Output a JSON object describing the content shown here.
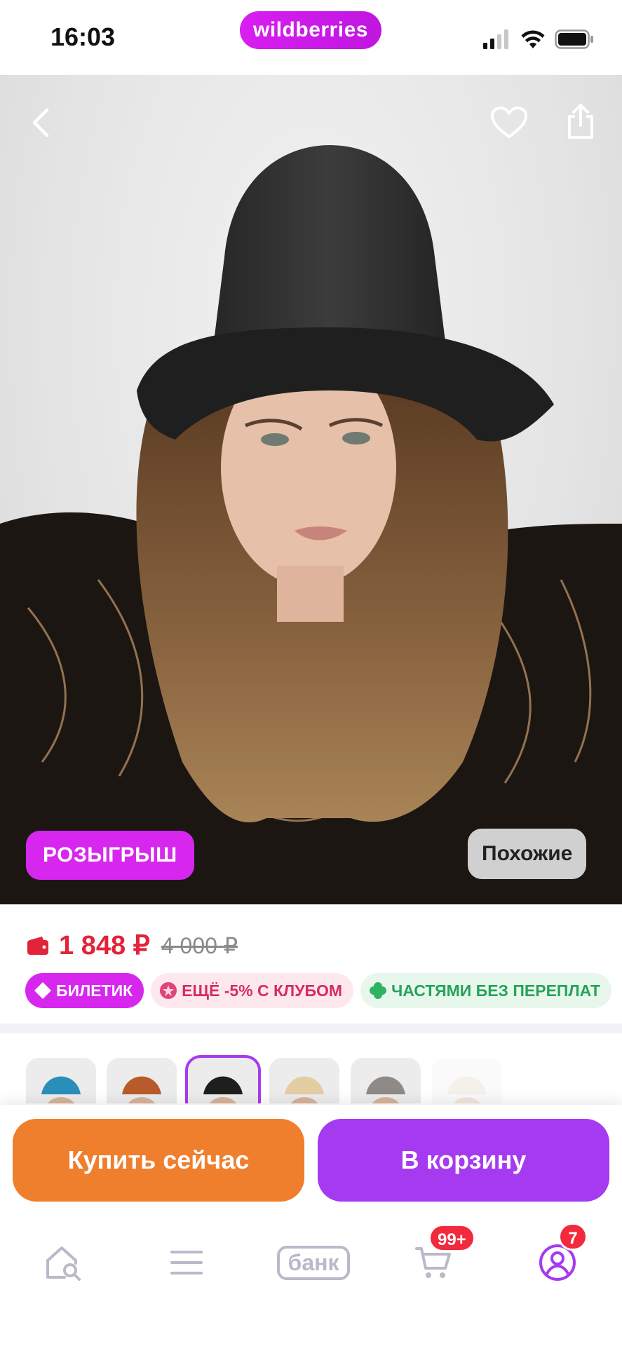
{
  "status_bar": {
    "time": "16:03",
    "brand": "wildberries"
  },
  "hero": {
    "back_icon": "chevron-left-icon",
    "favorite_icon": "heart-icon",
    "share_icon": "share-icon",
    "badge_giveaway": "РОЗЫГРЫШ",
    "badge_similar": "Похожие"
  },
  "price": {
    "current": "1 848 ₽",
    "old": "4 000 ₽",
    "current_color": "#e2243a"
  },
  "promos": [
    {
      "label": "БИЛЕТИК",
      "icon": "ticket-icon"
    },
    {
      "label": "ЕЩЁ -5% С КЛУБОМ",
      "icon": "club-star-icon"
    },
    {
      "label": "ЧАСТЯМИ БЕЗ ПЕРЕПЛАТ",
      "icon": "clover-icon"
    }
  ],
  "thumbnails": [
    {
      "color": "#2a8fb8",
      "selected": false
    },
    {
      "color": "#b85a2a",
      "selected": false
    },
    {
      "color": "#1e1e1e",
      "selected": true
    },
    {
      "color": "#e3cda3",
      "selected": false
    },
    {
      "color": "#8e8a88",
      "selected": false
    },
    {
      "color": "#ebe3d6",
      "selected": false
    }
  ],
  "actions": {
    "buy_now": "Купить сейчас",
    "add_to_cart": "В корзину"
  },
  "tabbar": {
    "home_icon": "home-search-icon",
    "catalog_icon": "menu-icon",
    "bank_label": "банк",
    "cart_icon": "cart-icon",
    "cart_count": "99+",
    "profile_icon": "profile-icon",
    "profile_count": "7"
  },
  "colors": {
    "brand": "#cb11ab",
    "buy": "#ef7f2c",
    "cart": "#a53af0",
    "accent_purple": "#a73af0"
  }
}
